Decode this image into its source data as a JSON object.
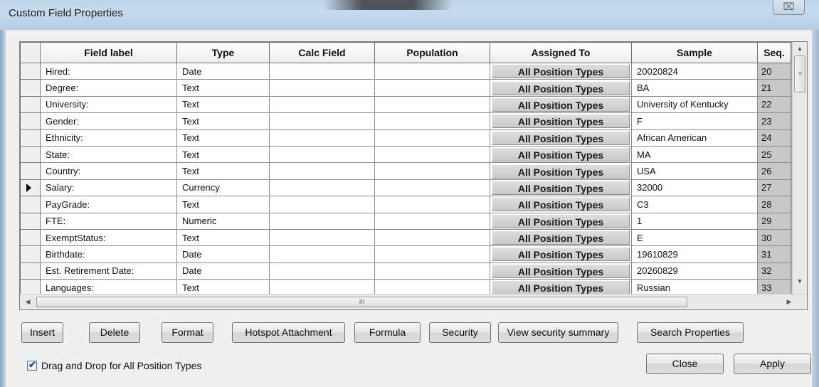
{
  "window": {
    "title": "Custom Field Properties",
    "close_glyph": "⌧"
  },
  "grid": {
    "columns": [
      "Field label",
      "Type",
      "Calc Field",
      "Population",
      "Assigned To",
      "Sample",
      "Seq."
    ],
    "selected_row_index": 7,
    "rows": [
      {
        "label": "Hired:",
        "type": "Date",
        "calc": "",
        "population": "",
        "assigned": "All Position Types",
        "sample": "20020824",
        "seq": "20"
      },
      {
        "label": "Degree:",
        "type": "Text",
        "calc": "",
        "population": "",
        "assigned": "All Position Types",
        "sample": "BA",
        "seq": "21"
      },
      {
        "label": "University:",
        "type": "Text",
        "calc": "",
        "population": "",
        "assigned": "All Position Types",
        "sample": "University of Kentucky",
        "seq": "22"
      },
      {
        "label": "Gender:",
        "type": "Text",
        "calc": "",
        "population": "",
        "assigned": "All Position Types",
        "sample": "F",
        "seq": "23"
      },
      {
        "label": "Ethnicity:",
        "type": "Text",
        "calc": "",
        "population": "",
        "assigned": "All Position Types",
        "sample": "African American",
        "seq": "24"
      },
      {
        "label": "State:",
        "type": "Text",
        "calc": "",
        "population": "",
        "assigned": "All Position Types",
        "sample": "MA",
        "seq": "25"
      },
      {
        "label": "Country:",
        "type": "Text",
        "calc": "",
        "population": "",
        "assigned": "All Position Types",
        "sample": "USA",
        "seq": "26"
      },
      {
        "label": "Salary:",
        "type": "Currency",
        "calc": "",
        "population": "",
        "assigned": "All Position Types",
        "sample": "32000",
        "seq": "27"
      },
      {
        "label": "PayGrade:",
        "type": "Text",
        "calc": "",
        "population": "",
        "assigned": "All Position Types",
        "sample": "C3",
        "seq": "28"
      },
      {
        "label": "FTE:",
        "type": "Numeric",
        "calc": "",
        "population": "",
        "assigned": "All Position Types",
        "sample": "1",
        "seq": "29"
      },
      {
        "label": "ExemptStatus:",
        "type": "Text",
        "calc": "",
        "population": "",
        "assigned": "All Position Types",
        "sample": "E",
        "seq": "30"
      },
      {
        "label": "Birthdate:",
        "type": "Date",
        "calc": "",
        "population": "",
        "assigned": "All Position Types",
        "sample": "19610829",
        "seq": "31"
      },
      {
        "label": "Est. Retirement Date:",
        "type": "Date",
        "calc": "",
        "population": "",
        "assigned": "All Position Types",
        "sample": "20260829",
        "seq": "32"
      },
      {
        "label": "Languages:",
        "type": "Text",
        "calc": "",
        "population": "",
        "assigned": "All Position Types",
        "sample": "Russian",
        "seq": "33"
      }
    ]
  },
  "scrollbars": {
    "up": "▲",
    "down": "▼",
    "left": "◀",
    "right": "▶",
    "h_grip": "III",
    "v_grip": "≡"
  },
  "buttons": {
    "insert": "Insert",
    "delete": "Delete",
    "format": "Format",
    "hotspot": "Hotspot Attachment",
    "formula": "Formula",
    "security": "Security",
    "view_security": "View security summary",
    "search_properties": "Search Properties",
    "close": "Close",
    "apply": "Apply"
  },
  "options": {
    "drag_drop_label": "Drag and Drop for All Position Types",
    "drag_drop_checked": true,
    "check_glyph": "✔"
  }
}
